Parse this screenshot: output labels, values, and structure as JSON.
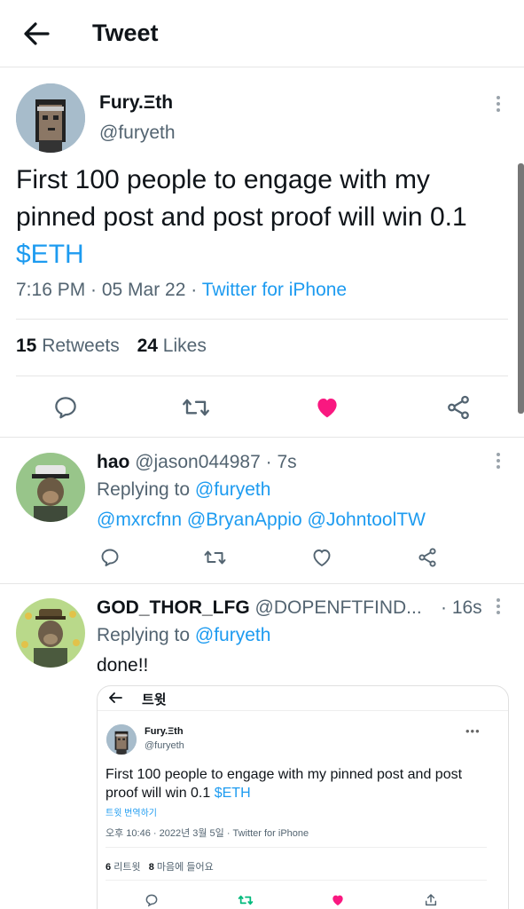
{
  "header": {
    "title": "Tweet"
  },
  "tweet": {
    "name": "Fury.Ξth",
    "handle": "@furyeth",
    "text_main": "First 100 people to engage with my pinned post and post proof will win 0.1 ",
    "cashtag": "$ETH",
    "time_date": "7:16 PM · 05 Mar 22 · ",
    "source": "Twitter for iPhone",
    "retweets_count": "15",
    "retweets_label": "Retweets",
    "likes_count": "24",
    "likes_label": "Likes",
    "liked": true,
    "colors": {
      "accent": "#1d9bf0",
      "like": "#f91880",
      "retweet": "#00ba7c"
    }
  },
  "replies": [
    {
      "name": "hao",
      "handle": "@jason044987",
      "time": "· 7s",
      "replying_label": "Replying to ",
      "replying_to": "@furyeth",
      "mentions": "@mxrcfnn @BryanAppio @JohntoolTW"
    },
    {
      "name": "GOD_THOR_LFG",
      "handle": "@DOPENFTFIND...",
      "time": "· 16s",
      "replying_label": "Replying to ",
      "replying_to": "@furyeth",
      "text": "done!!"
    }
  ],
  "embed": {
    "title": "트윗",
    "name": "Fury.Ξth",
    "handle": "@furyeth",
    "text_main": "First 100 people to engage with my pinned post and post proof will win 0.1 ",
    "cashtag": "$ETH",
    "translate": "트윗 번역하기",
    "meta_time": "오후 10:46 · 2022년 3월 5일 · Twitter for iPhone",
    "retweets_count": "6",
    "retweets_label": "리트윗",
    "likes_count": "8",
    "likes_label": "마음에 들어요"
  },
  "icons": [
    "back-arrow-icon",
    "more-icon",
    "reply-icon",
    "retweet-icon",
    "heart-icon",
    "share-icon"
  ]
}
